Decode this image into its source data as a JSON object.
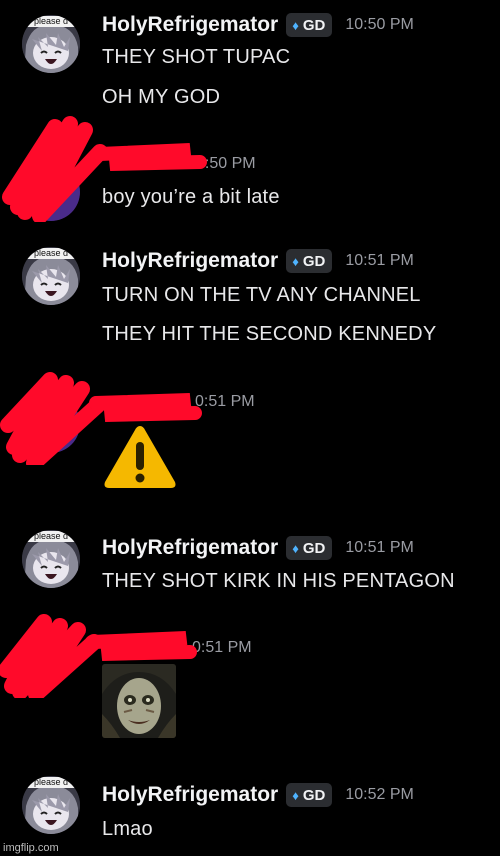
{
  "groups": [
    {
      "avatar_caption": "please d",
      "username": "HolyRefrigemator",
      "badge": "GD",
      "time": "10:50 PM",
      "lines": [
        "THEY SHOT TUPAC",
        "OH MY GOD"
      ]
    },
    {
      "redacted": true,
      "time_fragment": "0:50 PM",
      "lines": [
        "boy you’re a bit late"
      ]
    },
    {
      "avatar_caption": "please d",
      "username": "HolyRefrigemator",
      "badge": "GD",
      "time": "10:51 PM",
      "lines": [
        "TURN ON THE TV ANY CHANNEL",
        "THEY HIT THE SECOND KENNEDY"
      ]
    },
    {
      "redacted": true,
      "time_fragment": "0:51 PM",
      "attachment": "warning-emoji"
    },
    {
      "avatar_caption": "please d",
      "username": "HolyRefrigemator",
      "badge": "GD",
      "time": "10:51 PM",
      "lines": [
        "THEY SHOT KIRK IN HIS PENTAGON"
      ]
    },
    {
      "redacted": true,
      "time_fragment": "0:51 PM",
      "attachment": "horror-face-image"
    },
    {
      "avatar_caption": "please d",
      "username": "HolyRefrigemator",
      "badge": "GD",
      "time": "10:52 PM",
      "lines": [
        "Lmao"
      ]
    }
  ],
  "watermark": "imgflip.com",
  "colors": {
    "background": "#000000",
    "username": "#f2f3f5",
    "timestamp": "#9a9ca3",
    "badge_bg": "#2b2d31",
    "badge_gem": "#4fb3ff",
    "redaction": "#ff0a2a",
    "warning": "#f5b800"
  }
}
